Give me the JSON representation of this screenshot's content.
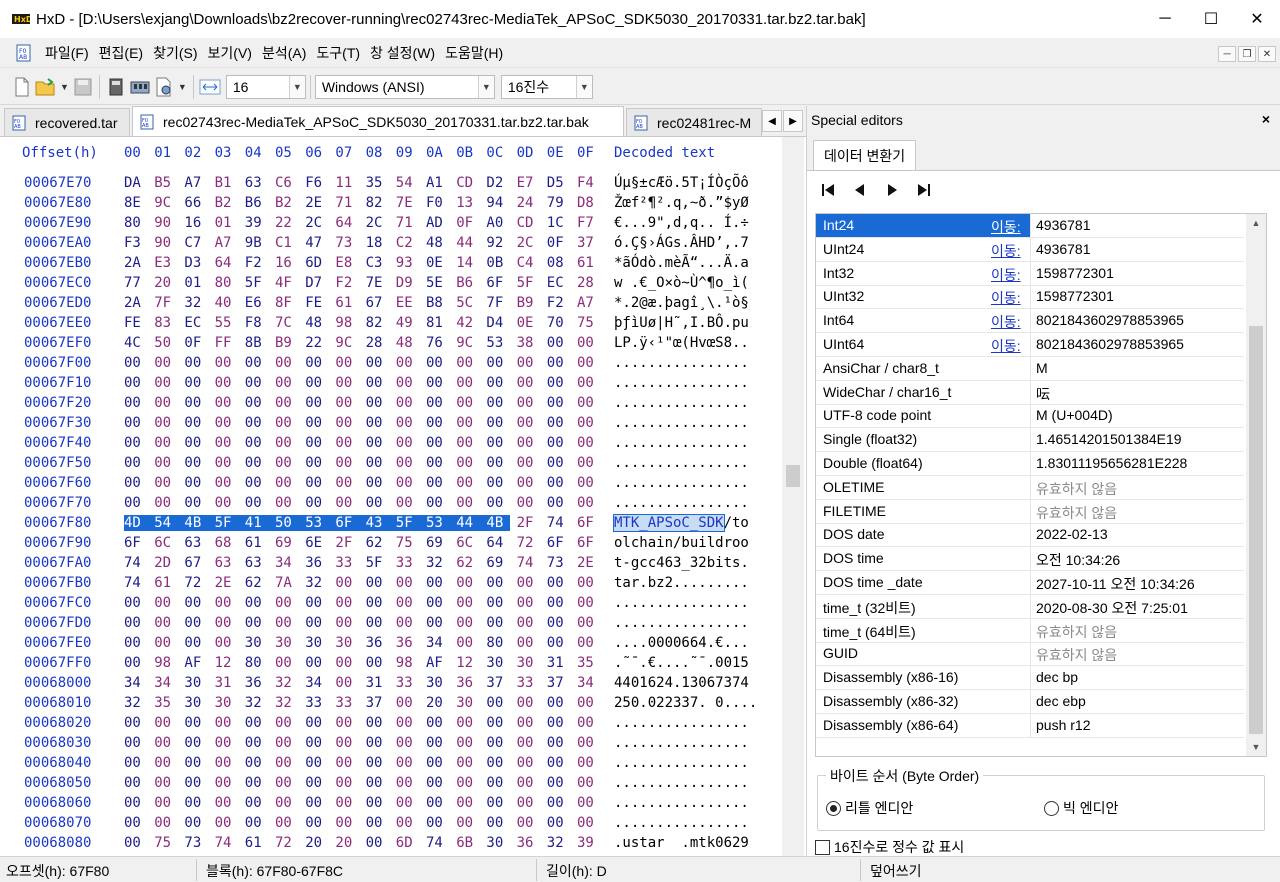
{
  "window": {
    "title": "HxD - [D:\\Users\\exjang\\Downloads\\bz2recover-running\\rec02743rec-MediaTek_APSoC_SDK5030_20170331.tar.bz2.tar.bak]",
    "minimize": "─",
    "maximize": "☐",
    "close": "✕"
  },
  "menu": {
    "items": [
      "파일(F)",
      "편집(E)",
      "찾기(S)",
      "보기(V)",
      "분석(A)",
      "도구(T)",
      "창 설정(W)",
      "도움말(H)"
    ]
  },
  "toolbar": {
    "bytes_per_row": "16",
    "charset": "Windows (ANSI)",
    "offset_base": "16진수"
  },
  "tabs": [
    {
      "label": "recovered.tar"
    },
    {
      "label": "rec02743rec-MediaTek_APSoC_SDK5030_20170331.tar.bz2.tar.bak"
    },
    {
      "label": "rec02481rec-M"
    }
  ],
  "hex": {
    "header_offset": "Offset(h)",
    "header_cols": [
      "00",
      "01",
      "02",
      "03",
      "04",
      "05",
      "06",
      "07",
      "08",
      "09",
      "0A",
      "0B",
      "0C",
      "0D",
      "0E",
      "0F"
    ],
    "header_text": "Decoded text",
    "rows": [
      {
        "off": "00067E70",
        "bytes": "DA B5 A7 B1 63 C6 F6 11 35 54 A1 CD D2 E7 D5 F4",
        "text": "Úµ§±cÆö.5T¡ÍÒçÕô"
      },
      {
        "off": "00067E80",
        "bytes": "8E 9C 66 B2 B6 B2 2E 71 82 7E F0 13 94 24 79 D8",
        "text": "Žœf²¶².q‚~ð.”$yØ"
      },
      {
        "off": "00067E90",
        "bytes": "80 90 16 01 39 22 2C 64 2C 71 AD 0F A0 CD 1C F7",
        "text": "€...9\",d,q.. Í.÷"
      },
      {
        "off": "00067EA0",
        "bytes": "F3 90 C7 A7 9B C1 47 73 18 C2 48 44 92 2C 0F 37",
        "text": "ó.Ç§›ÁGs.ÂHD’,.7"
      },
      {
        "off": "00067EB0",
        "bytes": "2A E3 D3 64 F2 16 6D E8 C3 93 0E 14 0B C4 08 61",
        "text": "*ãÓdò.mèÃ“...Ä.a"
      },
      {
        "off": "00067EC0",
        "bytes": "77 20 01 80 5F 4F D7 F2 7E D9 5E B6 6F 5F EC 28",
        "text": "w .€_O×ò~Ù^¶o_ì("
      },
      {
        "off": "00067ED0",
        "bytes": "2A 7F 32 40 E6 8F FE 61 67 EE B8 5C 7F B9 F2 A7",
        "text": "*.2@æ.þagî¸\\.¹ò§"
      },
      {
        "off": "00067EE0",
        "bytes": "FE 83 EC 55 F8 7C 48 98 82 49 81 42 D4 0E 70 75",
        "text": "þƒìUø|H˜‚I.BÔ.pu"
      },
      {
        "off": "00067EF0",
        "bytes": "4C 50 0F FF 8B B9 22 9C 28 48 76 9C 53 38 00 00",
        "text": "LP.ÿ‹¹\"œ(HvœS8.."
      },
      {
        "off": "00067F00",
        "bytes": "00 00 00 00 00 00 00 00 00 00 00 00 00 00 00 00",
        "text": "................"
      },
      {
        "off": "00067F10",
        "bytes": "00 00 00 00 00 00 00 00 00 00 00 00 00 00 00 00",
        "text": "................"
      },
      {
        "off": "00067F20",
        "bytes": "00 00 00 00 00 00 00 00 00 00 00 00 00 00 00 00",
        "text": "................"
      },
      {
        "off": "00067F30",
        "bytes": "00 00 00 00 00 00 00 00 00 00 00 00 00 00 00 00",
        "text": "................"
      },
      {
        "off": "00067F40",
        "bytes": "00 00 00 00 00 00 00 00 00 00 00 00 00 00 00 00",
        "text": "................"
      },
      {
        "off": "00067F50",
        "bytes": "00 00 00 00 00 00 00 00 00 00 00 00 00 00 00 00",
        "text": "................"
      },
      {
        "off": "00067F60",
        "bytes": "00 00 00 00 00 00 00 00 00 00 00 00 00 00 00 00",
        "text": "................"
      },
      {
        "off": "00067F70",
        "bytes": "00 00 00 00 00 00 00 00 00 00 00 00 00 00 00 00",
        "text": "................"
      },
      {
        "off": "00067F80",
        "bytes": "4D 54 4B 5F 41 50 53 6F 43 5F 53 44 4B 2F 74 6F",
        "text": "MTK_APSoC_SDK/to",
        "sel": 13
      },
      {
        "off": "00067F90",
        "bytes": "6F 6C 63 68 61 69 6E 2F 62 75 69 6C 64 72 6F 6F",
        "text": "olchain/buildroo"
      },
      {
        "off": "00067FA0",
        "bytes": "74 2D 67 63 63 34 36 33 5F 33 32 62 69 74 73 2E",
        "text": "t-gcc463_32bits."
      },
      {
        "off": "00067FB0",
        "bytes": "74 61 72 2E 62 7A 32 00 00 00 00 00 00 00 00 00",
        "text": "tar.bz2........."
      },
      {
        "off": "00067FC0",
        "bytes": "00 00 00 00 00 00 00 00 00 00 00 00 00 00 00 00",
        "text": "................"
      },
      {
        "off": "00067FD0",
        "bytes": "00 00 00 00 00 00 00 00 00 00 00 00 00 00 00 00",
        "text": "................"
      },
      {
        "off": "00067FE0",
        "bytes": "00 00 00 00 30 30 30 30 36 36 34 00 80 00 00 00",
        "text": "....0000664.€..."
      },
      {
        "off": "00067FF0",
        "bytes": "00 98 AF 12 80 00 00 00 00 98 AF 12 30 30 31 35",
        "text": ".˜¯.€....˜¯.0015"
      },
      {
        "off": "00068000",
        "bytes": "34 34 30 31 36 32 34 00 31 33 30 36 37 33 37 34",
        "text": "4401624.13067374"
      },
      {
        "off": "00068010",
        "bytes": "32 35 30 30 32 32 33 33 37 00 20 30 00 00 00 00",
        "text": "250.022337. 0...."
      },
      {
        "off": "00068020",
        "bytes": "00 00 00 00 00 00 00 00 00 00 00 00 00 00 00 00",
        "text": "................"
      },
      {
        "off": "00068030",
        "bytes": "00 00 00 00 00 00 00 00 00 00 00 00 00 00 00 00",
        "text": "................"
      },
      {
        "off": "00068040",
        "bytes": "00 00 00 00 00 00 00 00 00 00 00 00 00 00 00 00",
        "text": "................"
      },
      {
        "off": "00068050",
        "bytes": "00 00 00 00 00 00 00 00 00 00 00 00 00 00 00 00",
        "text": "................"
      },
      {
        "off": "00068060",
        "bytes": "00 00 00 00 00 00 00 00 00 00 00 00 00 00 00 00",
        "text": "................"
      },
      {
        "off": "00068070",
        "bytes": "00 00 00 00 00 00 00 00 00 00 00 00 00 00 00 00",
        "text": "................"
      },
      {
        "off": "00068080",
        "bytes": "00 75 73 74 61 72 20 20 00 6D 74 6B 30 36 32 39",
        "text": ".ustar  .mtk0629"
      }
    ]
  },
  "status": {
    "offset": "오프셋(h): 67F80",
    "block": "블록(h): 67F80-67F8C",
    "length": "길이(h): D",
    "mode": "덮어쓰기"
  },
  "special": {
    "title": "Special editors",
    "close": "×",
    "tab": "데이터 변환기",
    "goto_label": "이동:",
    "rows": [
      {
        "name": "Int24",
        "goto": true,
        "value": "4936781",
        "selected": true
      },
      {
        "name": "UInt24",
        "goto": true,
        "value": "4936781"
      },
      {
        "name": "Int32",
        "goto": true,
        "value": "1598772301"
      },
      {
        "name": "UInt32",
        "goto": true,
        "value": "1598772301"
      },
      {
        "name": "Int64",
        "goto": true,
        "value": "8021843602978853965"
      },
      {
        "name": "UInt64",
        "goto": true,
        "value": "8021843602978853965"
      },
      {
        "name": "AnsiChar / char8_t",
        "value": "M"
      },
      {
        "name": "WideChar / char16_t",
        "value": "呍"
      },
      {
        "name": "UTF-8 code point",
        "value": "M (U+004D)"
      },
      {
        "name": "Single (float32)",
        "value": "1.46514201501384E19"
      },
      {
        "name": "Double (float64)",
        "value": "1.83011195656281E228"
      },
      {
        "name": "OLETIME",
        "value": "유효하지 않음",
        "dim": true
      },
      {
        "name": "FILETIME",
        "value": "유효하지 않음",
        "dim": true
      },
      {
        "name": "DOS date",
        "value": "2022-02-13"
      },
      {
        "name": "DOS time",
        "value": "오전 10:34:26"
      },
      {
        "name": "DOS time _date",
        "value": "2027-10-11 오전 10:34:26"
      },
      {
        "name": "time_t (32비트)",
        "value": "2020-08-30 오전 7:25:01"
      },
      {
        "name": "time_t (64비트)",
        "value": "유효하지 않음",
        "dim": true
      },
      {
        "name": "GUID",
        "value": "유효하지 않음",
        "dim": true
      },
      {
        "name": "Disassembly (x86-16)",
        "value": "dec bp"
      },
      {
        "name": "Disassembly (x86-32)",
        "value": "dec ebp"
      },
      {
        "name": "Disassembly (x86-64)",
        "value": "push r12"
      }
    ],
    "byte_order_label": "바이트 순서 (Byte Order)",
    "little_endian": "리틀 엔디안",
    "big_endian": "빅 엔디안",
    "hex_checkbox": "16진수로 정수 값 표시"
  }
}
